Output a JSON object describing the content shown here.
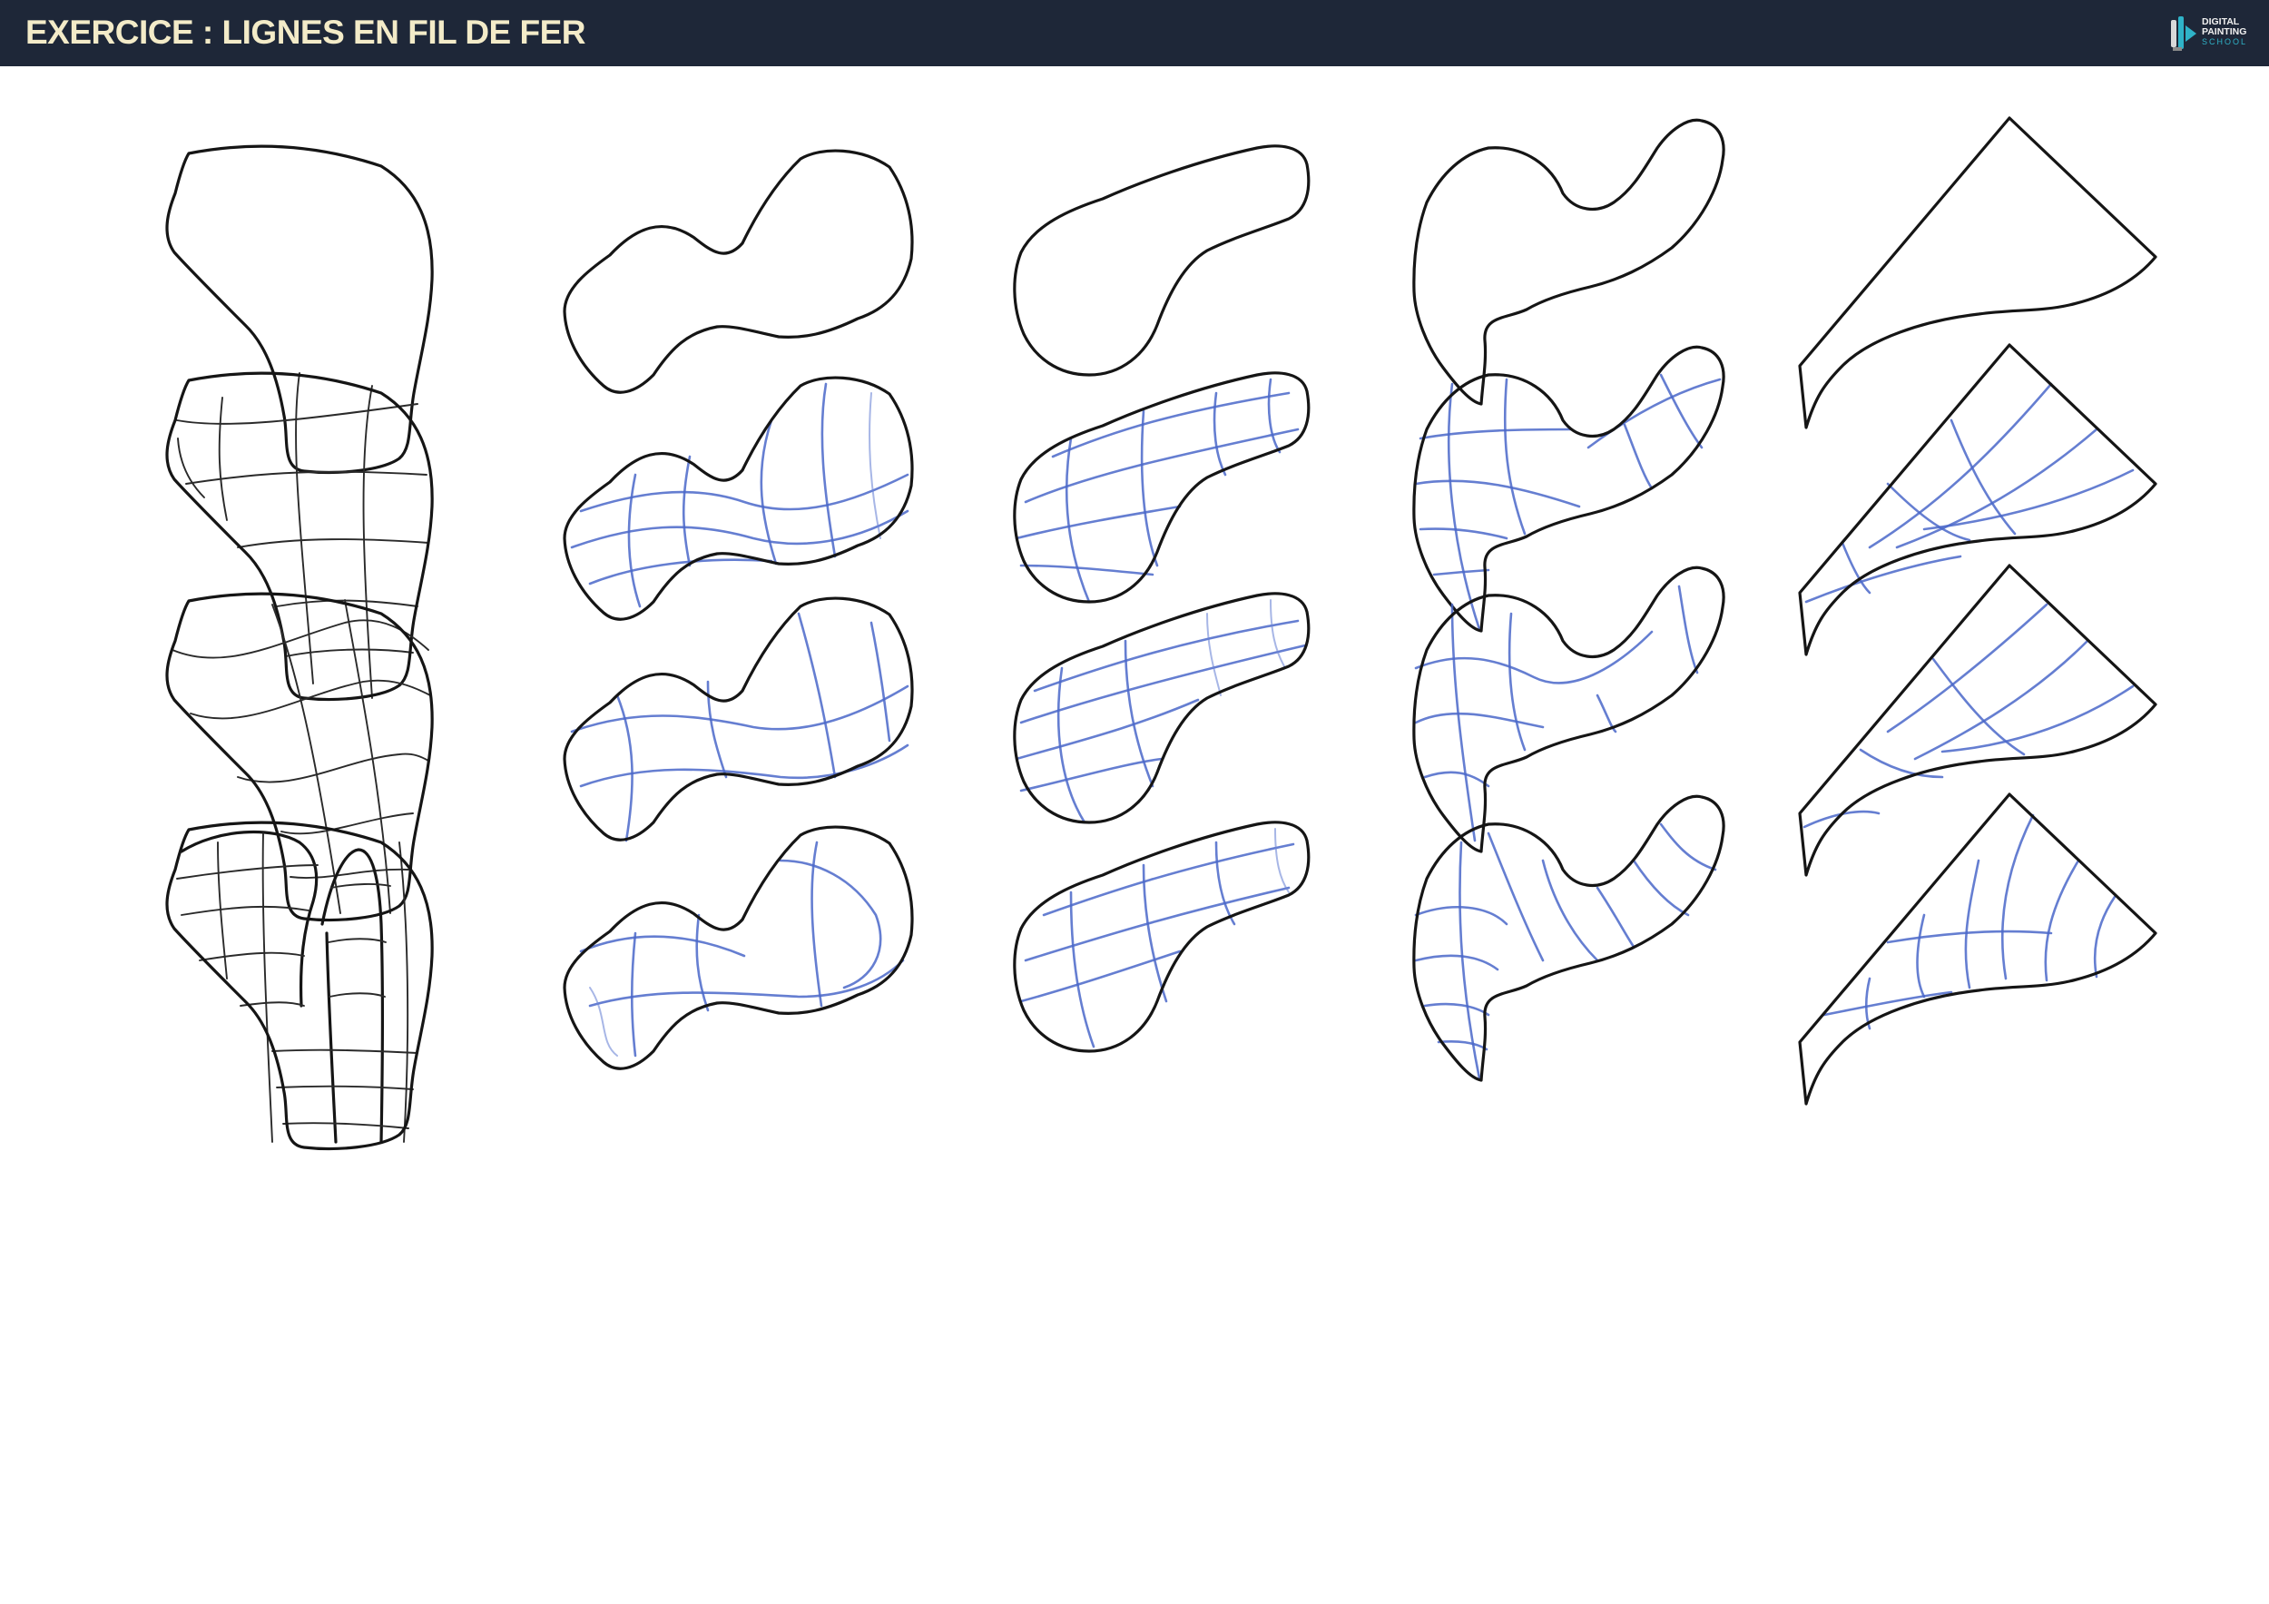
{
  "header": {
    "title": "EXERCICE : LIGNES EN FIL DE FER",
    "logo": {
      "line1": "DIGITAL",
      "line2": "PAINTING",
      "line3": "SCHOOL",
      "icon": "paintbrush-logo-icon"
    }
  },
  "colors": {
    "header_bg": "#1e2738",
    "title": "#f3ebc8",
    "outline": "#151515",
    "wireframe_blue": "#4a67c9",
    "background": "#ffffff"
  },
  "grid": {
    "rows": 4,
    "columns": 5,
    "row1": "outlines only",
    "rows2to4": "wireframe contour lines"
  }
}
